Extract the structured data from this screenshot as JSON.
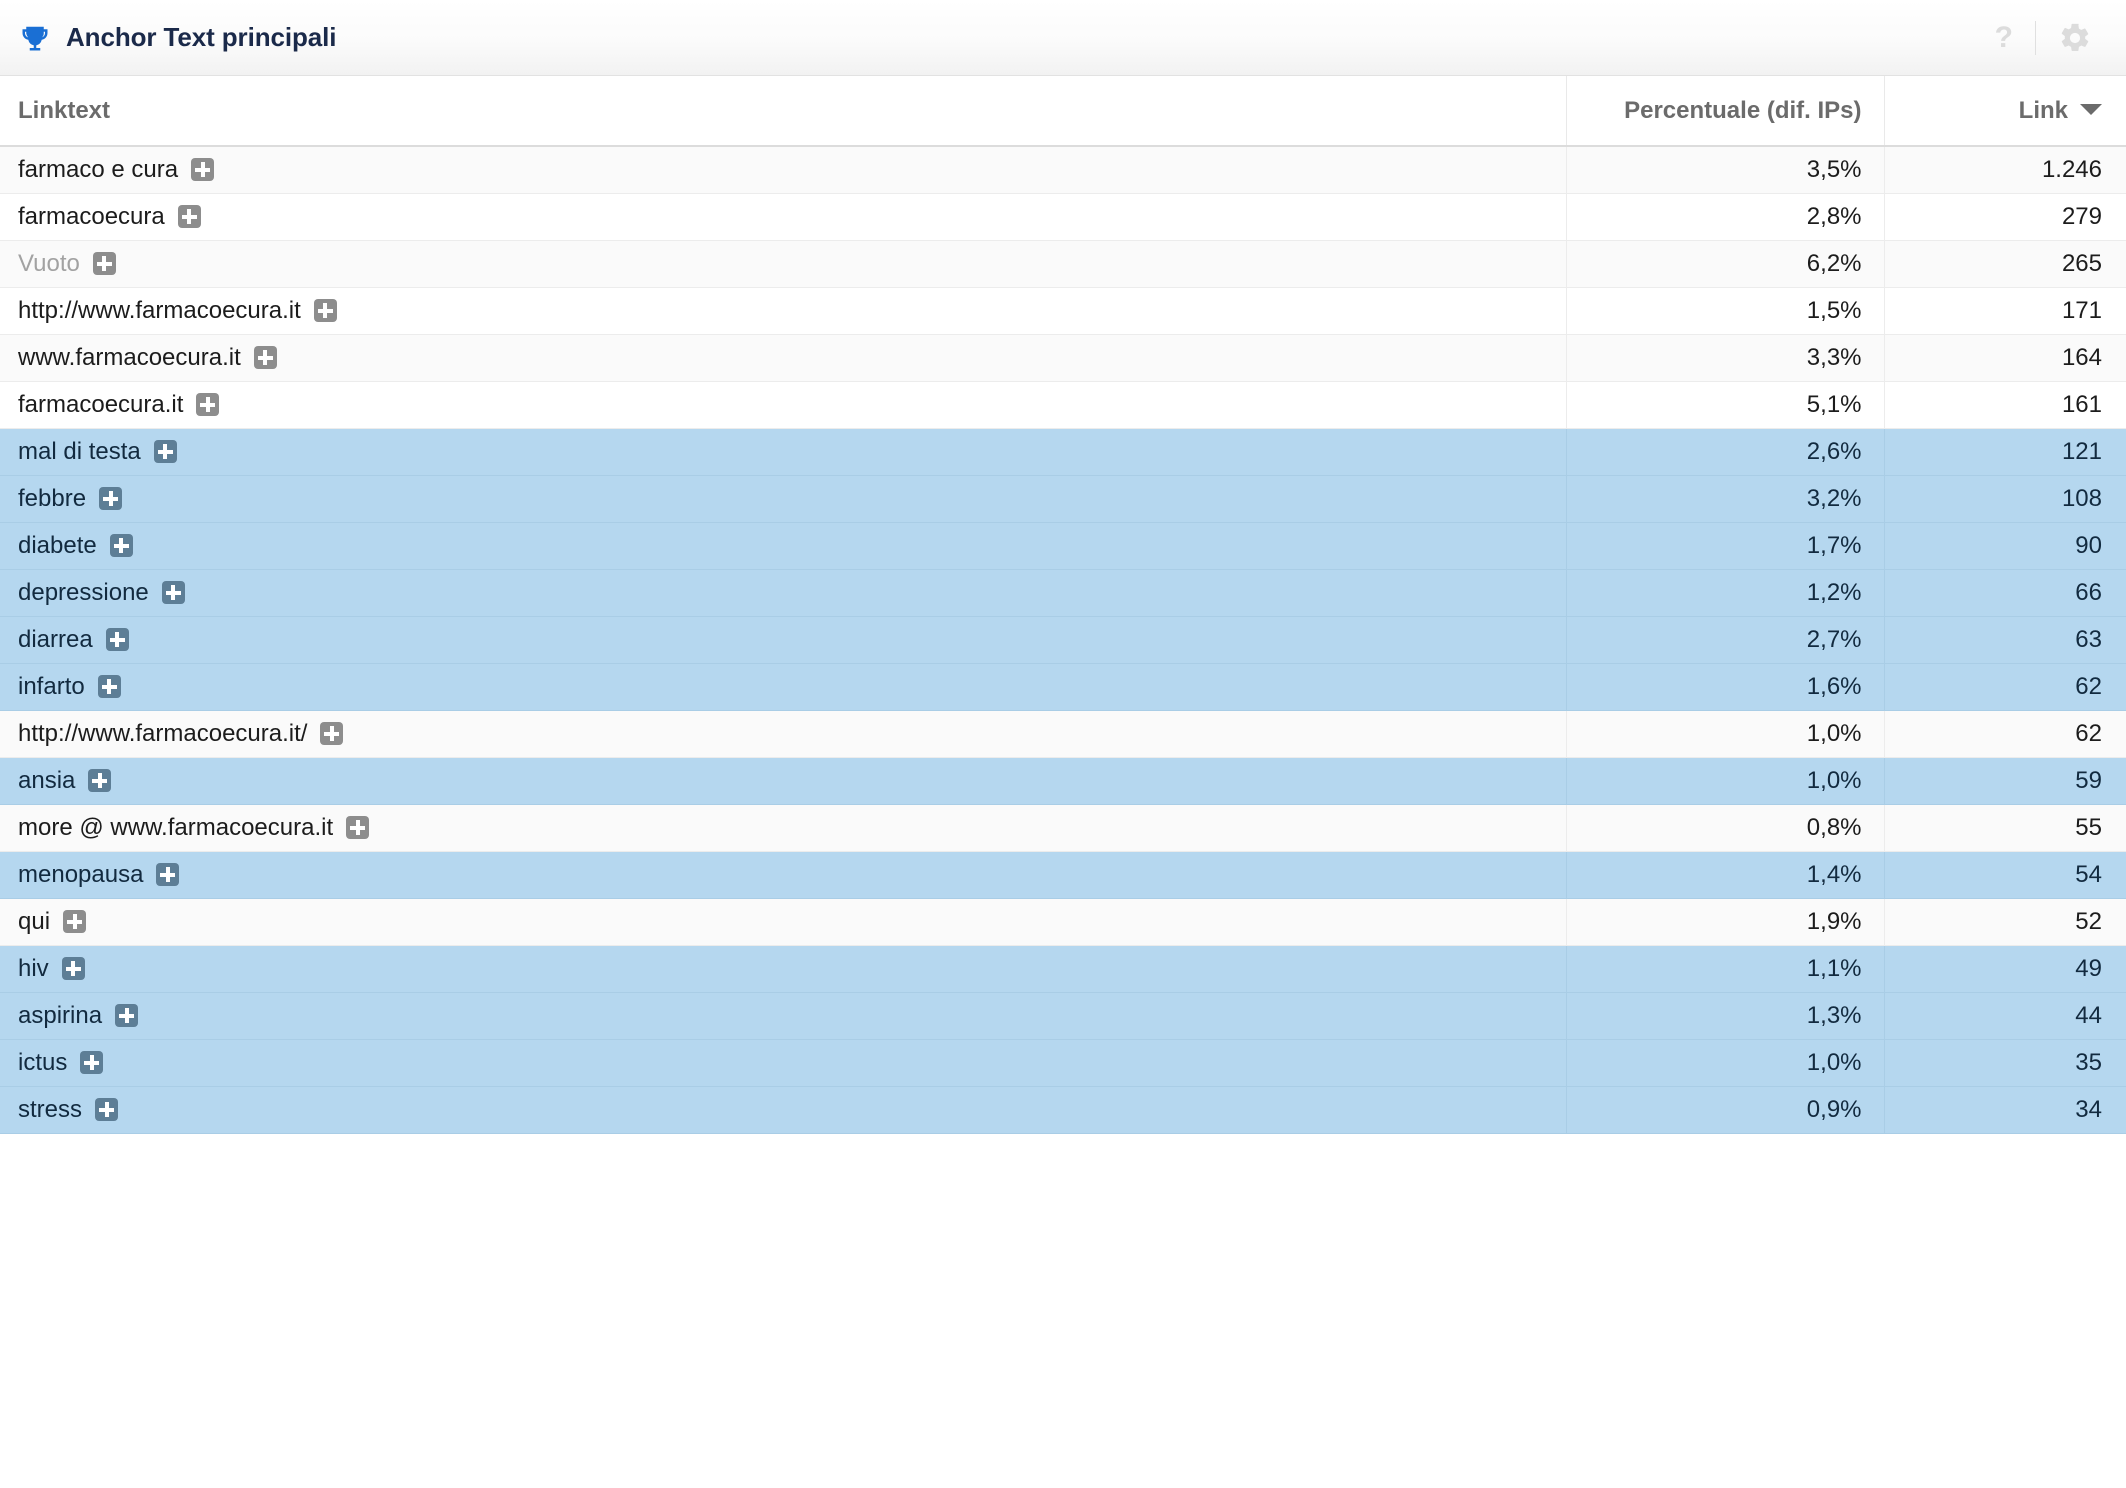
{
  "header": {
    "title": "Anchor Text principali",
    "trophy_icon": "trophy-icon",
    "help_label": "?",
    "gear_icon": "gear-icon",
    "accent_color": "#1a6fd4",
    "title_color": "#1b2a4a"
  },
  "table": {
    "columns": {
      "linktext": "Linktext",
      "percentuale": "Percentuale (dif. IPs)",
      "link": "Link"
    },
    "sorted_by": "Link",
    "sort_direction": "desc",
    "selected_row_color": "#b5d7ef",
    "expand_icon": "plus-square-icon",
    "rows": [
      {
        "linktext": "farmaco e cura",
        "percentuale": "3,5%",
        "link": "1.246",
        "selected": false,
        "empty": false
      },
      {
        "linktext": "farmacoecura",
        "percentuale": "2,8%",
        "link": "279",
        "selected": false,
        "empty": false
      },
      {
        "linktext": "Vuoto",
        "percentuale": "6,2%",
        "link": "265",
        "selected": false,
        "empty": true
      },
      {
        "linktext": "http://www.farmacoecura.it",
        "percentuale": "1,5%",
        "link": "171",
        "selected": false,
        "empty": false
      },
      {
        "linktext": "www.farmacoecura.it",
        "percentuale": "3,3%",
        "link": "164",
        "selected": false,
        "empty": false
      },
      {
        "linktext": "farmacoecura.it",
        "percentuale": "5,1%",
        "link": "161",
        "selected": false,
        "empty": false
      },
      {
        "linktext": "mal di testa",
        "percentuale": "2,6%",
        "link": "121",
        "selected": true,
        "empty": false
      },
      {
        "linktext": "febbre",
        "percentuale": "3,2%",
        "link": "108",
        "selected": true,
        "empty": false
      },
      {
        "linktext": "diabete",
        "percentuale": "1,7%",
        "link": "90",
        "selected": true,
        "empty": false
      },
      {
        "linktext": "depressione",
        "percentuale": "1,2%",
        "link": "66",
        "selected": true,
        "empty": false
      },
      {
        "linktext": "diarrea",
        "percentuale": "2,7%",
        "link": "63",
        "selected": true,
        "empty": false
      },
      {
        "linktext": "infarto",
        "percentuale": "1,6%",
        "link": "62",
        "selected": true,
        "empty": false
      },
      {
        "linktext": "http://www.farmacoecura.it/",
        "percentuale": "1,0%",
        "link": "62",
        "selected": false,
        "empty": false
      },
      {
        "linktext": "ansia",
        "percentuale": "1,0%",
        "link": "59",
        "selected": true,
        "empty": false
      },
      {
        "linktext": "more @ www.farmacoecura.it",
        "percentuale": "0,8%",
        "link": "55",
        "selected": false,
        "empty": false
      },
      {
        "linktext": "menopausa",
        "percentuale": "1,4%",
        "link": "54",
        "selected": true,
        "empty": false
      },
      {
        "linktext": "qui",
        "percentuale": "1,9%",
        "link": "52",
        "selected": false,
        "empty": false
      },
      {
        "linktext": "hiv",
        "percentuale": "1,1%",
        "link": "49",
        "selected": true,
        "empty": false
      },
      {
        "linktext": "aspirina",
        "percentuale": "1,3%",
        "link": "44",
        "selected": true,
        "empty": false
      },
      {
        "linktext": "ictus",
        "percentuale": "1,0%",
        "link": "35",
        "selected": true,
        "empty": false
      },
      {
        "linktext": "stress",
        "percentuale": "0,9%",
        "link": "34",
        "selected": true,
        "empty": false
      }
    ]
  }
}
